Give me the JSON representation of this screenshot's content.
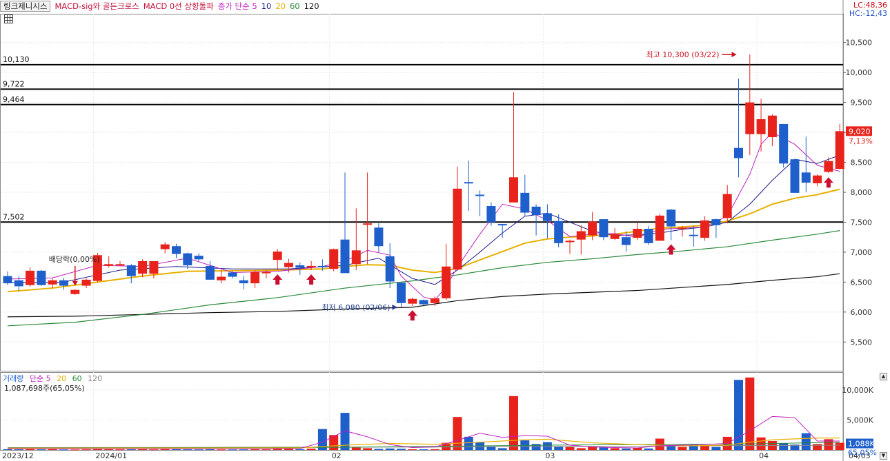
{
  "legend": {
    "name": "링크제니시스",
    "items": [
      {
        "text": "MACD-sig와 골든크로스",
        "color": "#c0103a"
      },
      {
        "text": "MACD 0선 상향돌파",
        "color": "#c0103a"
      },
      {
        "text": "종가 단순 5",
        "color": "#c020c0"
      },
      {
        "text": "10",
        "color": "#1a1a8a"
      },
      {
        "text": "20",
        "color": "#e8b000"
      },
      {
        "text": "60",
        "color": "#2a8a3a"
      },
      {
        "text": "120",
        "color": "#111111"
      }
    ]
  },
  "indicators": {
    "lc": "LC:48,36",
    "hc": "HC:-12,43"
  },
  "price_tag": {
    "value": "9,020",
    "pct": "7,13%"
  },
  "volume_legend": {
    "name": "거래량",
    "items": [
      {
        "text": "단순 5",
        "color": "#c020c0"
      },
      {
        "text": "20",
        "color": "#e8b000"
      },
      {
        "text": "60",
        "color": "#2a8a3a"
      },
      {
        "text": "120",
        "color": "#888888"
      }
    ],
    "info": "1,087,698주(65,05%)",
    "tag_value": "1,088K",
    "tag_pct": "65,05%"
  },
  "annotations": {
    "dividend": "배당락(0,00%)",
    "high": "최고 10,300 (03/22)",
    "low": "최저 6,080 (02/06)"
  },
  "colors": {
    "up": "#e8231c",
    "down": "#1e5fcc",
    "ma5": "#c020c0",
    "ma10": "#1a1a8a",
    "ma20": "#e8b000",
    "ma60": "#2a8a3a",
    "ma120": "#111111",
    "signal": "#cc0f2f"
  },
  "chart_data": {
    "type": "candlestick",
    "y_ticks": [
      "5,500",
      "6,000",
      "6,500",
      "7,000",
      "7,500",
      "8,000",
      "8,500",
      "9,000",
      "9,500",
      "10,000",
      "10,500"
    ],
    "ylim": [
      5020,
      10980
    ],
    "hlines": [
      {
        "value": 10130,
        "label": "10,130"
      },
      {
        "value": 9722,
        "label": "9,722"
      },
      {
        "value": 9464,
        "label": "9,464"
      },
      {
        "value": 7502,
        "label": "7,502"
      }
    ],
    "x_labels": [
      {
        "index": 0,
        "text": "2023/12"
      },
      {
        "index": 8,
        "text": "2024/01"
      },
      {
        "index": 29,
        "text": "02"
      },
      {
        "index": 48,
        "text": "03"
      },
      {
        "index": 67,
        "text": "04"
      },
      {
        "index": 72,
        "text": "04/03"
      }
    ],
    "candles": [
      {
        "o": 6600,
        "h": 6680,
        "l": 6450,
        "c": 6480
      },
      {
        "o": 6530,
        "h": 6600,
        "l": 6350,
        "c": 6430
      },
      {
        "o": 6450,
        "h": 6750,
        "l": 6420,
        "c": 6690
      },
      {
        "o": 6690,
        "h": 6700,
        "l": 6440,
        "c": 6450
      },
      {
        "o": 6460,
        "h": 6560,
        "l": 6400,
        "c": 6530
      },
      {
        "o": 6530,
        "h": 6570,
        "l": 6370,
        "c": 6440
      },
      {
        "o": 6300,
        "h": 6380,
        "l": 6290,
        "c": 6370
      },
      {
        "o": 6440,
        "h": 6560,
        "l": 6400,
        "c": 6540
      },
      {
        "o": 6520,
        "h": 6990,
        "l": 6500,
        "c": 6950
      },
      {
        "o": 6770,
        "h": 6930,
        "l": 6740,
        "c": 6800
      },
      {
        "o": 6790,
        "h": 6850,
        "l": 6770,
        "c": 6800
      },
      {
        "o": 6780,
        "h": 6800,
        "l": 6480,
        "c": 6600
      },
      {
        "o": 6640,
        "h": 6880,
        "l": 6580,
        "c": 6850
      },
      {
        "o": 6640,
        "h": 6820,
        "l": 6560,
        "c": 6850
      },
      {
        "o": 7050,
        "h": 7170,
        "l": 6980,
        "c": 7130
      },
      {
        "o": 7100,
        "h": 7140,
        "l": 6900,
        "c": 6970
      },
      {
        "o": 6980,
        "h": 6990,
        "l": 6720,
        "c": 6780
      },
      {
        "o": 6940,
        "h": 6980,
        "l": 6850,
        "c": 6880
      },
      {
        "o": 6770,
        "h": 6850,
        "l": 6560,
        "c": 6540
      },
      {
        "o": 6530,
        "h": 6700,
        "l": 6480,
        "c": 6590
      },
      {
        "o": 6660,
        "h": 6690,
        "l": 6560,
        "c": 6590
      },
      {
        "o": 6530,
        "h": 6600,
        "l": 6380,
        "c": 6480
      },
      {
        "o": 6480,
        "h": 6700,
        "l": 6400,
        "c": 6670
      },
      {
        "o": 6670,
        "h": 6700,
        "l": 6560,
        "c": 6670
      },
      {
        "o": 6870,
        "h": 7050,
        "l": 6700,
        "c": 7010
      },
      {
        "o": 6750,
        "h": 6890,
        "l": 6660,
        "c": 6820
      },
      {
        "o": 6780,
        "h": 6830,
        "l": 6620,
        "c": 6740
      },
      {
        "o": 6770,
        "h": 6850,
        "l": 6700,
        "c": 6770
      },
      {
        "o": 6770,
        "h": 6880,
        "l": 6690,
        "c": 6760
      },
      {
        "o": 6720,
        "h": 7060,
        "l": 6680,
        "c": 7050
      },
      {
        "o": 7210,
        "h": 8330,
        "l": 6700,
        "c": 6650
      },
      {
        "o": 6800,
        "h": 7730,
        "l": 6700,
        "c": 7030
      },
      {
        "o": 7470,
        "h": 8330,
        "l": 6800,
        "c": 7480
      },
      {
        "o": 7410,
        "h": 7480,
        "l": 7000,
        "c": 7100
      },
      {
        "o": 6930,
        "h": 7150,
        "l": 6400,
        "c": 6510
      },
      {
        "o": 6490,
        "h": 6500,
        "l": 6080,
        "c": 6150
      },
      {
        "o": 6140,
        "h": 6240,
        "l": 6100,
        "c": 6220
      },
      {
        "o": 6200,
        "h": 6210,
        "l": 6110,
        "c": 6130
      },
      {
        "o": 6150,
        "h": 6260,
        "l": 6100,
        "c": 6230
      },
      {
        "o": 6230,
        "h": 7140,
        "l": 6200,
        "c": 6760
      },
      {
        "o": 6710,
        "h": 8430,
        "l": 6700,
        "c": 8060
      },
      {
        "o": 8170,
        "h": 8530,
        "l": 7690,
        "c": 8160
      },
      {
        "o": 7960,
        "h": 8030,
        "l": 7600,
        "c": 7950
      },
      {
        "o": 7770,
        "h": 7830,
        "l": 7440,
        "c": 7500
      },
      {
        "o": 7470,
        "h": 7470,
        "l": 7240,
        "c": 7460
      },
      {
        "o": 7830,
        "h": 9670,
        "l": 7830,
        "c": 8250
      },
      {
        "o": 7990,
        "h": 8290,
        "l": 7610,
        "c": 7660
      },
      {
        "o": 7760,
        "h": 7800,
        "l": 7280,
        "c": 7620
      },
      {
        "o": 7650,
        "h": 7800,
        "l": 7230,
        "c": 7520
      },
      {
        "o": 7520,
        "h": 7630,
        "l": 7080,
        "c": 7150
      },
      {
        "o": 7180,
        "h": 7210,
        "l": 6970,
        "c": 7190
      },
      {
        "o": 7210,
        "h": 7450,
        "l": 6960,
        "c": 7350
      },
      {
        "o": 7280,
        "h": 7670,
        "l": 7200,
        "c": 7510
      },
      {
        "o": 7550,
        "h": 7550,
        "l": 7200,
        "c": 7250
      },
      {
        "o": 7220,
        "h": 7400,
        "l": 7200,
        "c": 7300
      },
      {
        "o": 7250,
        "h": 7350,
        "l": 7010,
        "c": 7120
      },
      {
        "o": 7240,
        "h": 7520,
        "l": 7200,
        "c": 7390
      },
      {
        "o": 7390,
        "h": 7440,
        "l": 7120,
        "c": 7150
      },
      {
        "o": 7190,
        "h": 7640,
        "l": 7190,
        "c": 7610
      },
      {
        "o": 7710,
        "h": 7720,
        "l": 7200,
        "c": 7430
      },
      {
        "o": 7410,
        "h": 7440,
        "l": 7260,
        "c": 7410
      },
      {
        "o": 7290,
        "h": 7440,
        "l": 7090,
        "c": 7280
      },
      {
        "o": 7240,
        "h": 7600,
        "l": 7190,
        "c": 7530
      },
      {
        "o": 7550,
        "h": 7560,
        "l": 7240,
        "c": 7450
      },
      {
        "o": 7570,
        "h": 8120,
        "l": 7480,
        "c": 7970
      },
      {
        "o": 8740,
        "h": 9900,
        "l": 8250,
        "c": 8570
      },
      {
        "o": 8970,
        "h": 10300,
        "l": 8620,
        "c": 9500
      },
      {
        "o": 8970,
        "h": 9560,
        "l": 8680,
        "c": 9220
      },
      {
        "o": 8920,
        "h": 9300,
        "l": 8770,
        "c": 9280
      },
      {
        "o": 9140,
        "h": 9140,
        "l": 8410,
        "c": 8480
      },
      {
        "o": 8550,
        "h": 8560,
        "l": 7990,
        "c": 7990
      },
      {
        "o": 8330,
        "h": 8930,
        "l": 8000,
        "c": 8160
      },
      {
        "o": 8150,
        "h": 8300,
        "l": 8100,
        "c": 8280
      },
      {
        "o": 8340,
        "h": 8580,
        "l": 8320,
        "c": 8520
      },
      {
        "o": 8390,
        "h": 9140,
        "l": 8380,
        "c": 9020
      }
    ],
    "ma5": [
      [
        0,
        6550
      ],
      [
        4,
        6570
      ],
      [
        8,
        6780
      ],
      [
        12,
        6760
      ],
      [
        16,
        6900
      ],
      [
        20,
        6660
      ],
      [
        24,
        6680
      ],
      [
        28,
        6760
      ],
      [
        30,
        6850
      ],
      [
        32,
        7030
      ],
      [
        34,
        6950
      ],
      [
        35,
        6600
      ],
      [
        37,
        6250
      ],
      [
        38,
        6200
      ],
      [
        39,
        6420
      ],
      [
        40,
        6750
      ],
      [
        42,
        7300
      ],
      [
        44,
        7800
      ],
      [
        46,
        7720
      ],
      [
        48,
        7530
      ],
      [
        50,
        7260
      ],
      [
        52,
        7300
      ],
      [
        54,
        7310
      ],
      [
        56,
        7250
      ],
      [
        58,
        7380
      ],
      [
        60,
        7400
      ],
      [
        62,
        7420
      ],
      [
        64,
        7600
      ],
      [
        66,
        8300
      ],
      [
        67,
        8800
      ],
      [
        68,
        9000
      ],
      [
        70,
        8800
      ],
      [
        72,
        8450
      ],
      [
        74,
        8350
      ]
    ],
    "ma10": [
      [
        0,
        6490
      ],
      [
        5,
        6500
      ],
      [
        10,
        6700
      ],
      [
        15,
        6760
      ],
      [
        20,
        6720
      ],
      [
        25,
        6720
      ],
      [
        30,
        6780
      ],
      [
        33,
        6900
      ],
      [
        36,
        6560
      ],
      [
        38,
        6460
      ],
      [
        40,
        6700
      ],
      [
        42,
        7000
      ],
      [
        44,
        7320
      ],
      [
        46,
        7600
      ],
      [
        48,
        7650
      ],
      [
        50,
        7500
      ],
      [
        52,
        7350
      ],
      [
        54,
        7280
      ],
      [
        56,
        7290
      ],
      [
        58,
        7320
      ],
      [
        60,
        7380
      ],
      [
        62,
        7420
      ],
      [
        64,
        7500
      ],
      [
        66,
        7800
      ],
      [
        68,
        8200
      ],
      [
        70,
        8550
      ],
      [
        72,
        8480
      ],
      [
        74,
        8620
      ]
    ],
    "ma20": [
      [
        0,
        6340
      ],
      [
        4,
        6400
      ],
      [
        8,
        6500
      ],
      [
        12,
        6600
      ],
      [
        16,
        6680
      ],
      [
        20,
        6690
      ],
      [
        24,
        6700
      ],
      [
        28,
        6720
      ],
      [
        30,
        6760
      ],
      [
        32,
        6790
      ],
      [
        34,
        6780
      ],
      [
        36,
        6700
      ],
      [
        38,
        6660
      ],
      [
        40,
        6730
      ],
      [
        42,
        6870
      ],
      [
        44,
        7010
      ],
      [
        46,
        7150
      ],
      [
        48,
        7220
      ],
      [
        50,
        7250
      ],
      [
        52,
        7270
      ],
      [
        54,
        7300
      ],
      [
        56,
        7350
      ],
      [
        58,
        7400
      ],
      [
        60,
        7420
      ],
      [
        62,
        7450
      ],
      [
        64,
        7520
      ],
      [
        66,
        7640
      ],
      [
        68,
        7800
      ],
      [
        70,
        7900
      ],
      [
        72,
        7960
      ],
      [
        74,
        8050
      ]
    ],
    "ma60": [
      [
        0,
        5770
      ],
      [
        6,
        5830
      ],
      [
        12,
        5960
      ],
      [
        18,
        6120
      ],
      [
        24,
        6240
      ],
      [
        30,
        6400
      ],
      [
        36,
        6520
      ],
      [
        40,
        6620
      ],
      [
        44,
        6740
      ],
      [
        48,
        6830
      ],
      [
        52,
        6890
      ],
      [
        56,
        6960
      ],
      [
        60,
        7020
      ],
      [
        64,
        7090
      ],
      [
        68,
        7200
      ],
      [
        72,
        7300
      ],
      [
        74,
        7360
      ]
    ],
    "ma120": [
      [
        0,
        5920
      ],
      [
        6,
        5930
      ],
      [
        12,
        5960
      ],
      [
        18,
        5990
      ],
      [
        24,
        6010
      ],
      [
        30,
        6050
      ],
      [
        36,
        6080
      ],
      [
        40,
        6190
      ],
      [
        44,
        6260
      ],
      [
        48,
        6300
      ],
      [
        52,
        6330
      ],
      [
        56,
        6360
      ],
      [
        60,
        6410
      ],
      [
        64,
        6460
      ],
      [
        68,
        6530
      ],
      [
        72,
        6590
      ],
      [
        74,
        6640
      ]
    ],
    "signals": [
      24,
      27,
      36,
      59,
      73
    ],
    "volume": {
      "ylim": [
        0,
        13000
      ],
      "y_ticks": [
        "5,000K",
        "10,000K"
      ],
      "values": [
        120,
        100,
        130,
        90,
        110,
        80,
        70,
        90,
        150,
        110,
        90,
        100,
        110,
        90,
        120,
        110,
        100,
        90,
        110,
        80,
        80,
        90,
        110,
        100,
        170,
        200,
        130,
        230,
        3500,
        2500,
        6200,
        400,
        300,
        180,
        250,
        200,
        120,
        110,
        130,
        1200,
        5500,
        2200,
        1300,
        600,
        300,
        9000,
        1600,
        1000,
        1300,
        600,
        500,
        300,
        600,
        400,
        300,
        250,
        350,
        250,
        1900,
        800,
        500,
        900,
        700,
        500,
        2200,
        11700,
        12100,
        2100,
        1500,
        1100,
        900,
        2800,
        1000,
        1800,
        1200
      ],
      "ma5": [
        [
          0,
          190
        ],
        [
          20,
          190
        ],
        [
          26,
          250
        ],
        [
          28,
          1300
        ],
        [
          30,
          3200
        ],
        [
          32,
          2200
        ],
        [
          34,
          900
        ],
        [
          36,
          400
        ],
        [
          38,
          500
        ],
        [
          40,
          1600
        ],
        [
          42,
          2800
        ],
        [
          44,
          2100
        ],
        [
          46,
          2400
        ],
        [
          48,
          2300
        ],
        [
          50,
          800
        ],
        [
          52,
          500
        ],
        [
          54,
          400
        ],
        [
          56,
          350
        ],
        [
          58,
          700
        ],
        [
          60,
          800
        ],
        [
          62,
          900
        ],
        [
          64,
          1100
        ],
        [
          66,
          3200
        ],
        [
          68,
          5600
        ],
        [
          70,
          5400
        ],
        [
          72,
          1500
        ],
        [
          74,
          1500
        ]
      ],
      "ma20": [
        [
          0,
          300
        ],
        [
          26,
          350
        ],
        [
          30,
          800
        ],
        [
          34,
          1100
        ],
        [
          38,
          950
        ],
        [
          42,
          1300
        ],
        [
          46,
          1700
        ],
        [
          48,
          1800
        ],
        [
          52,
          1200
        ],
        [
          56,
          900
        ],
        [
          60,
          700
        ],
        [
          64,
          800
        ],
        [
          66,
          1300
        ],
        [
          68,
          1700
        ],
        [
          72,
          2000
        ],
        [
          74,
          2000
        ]
      ],
      "ma60": [
        [
          0,
          330
        ],
        [
          30,
          450
        ],
        [
          40,
          650
        ],
        [
          48,
          800
        ],
        [
          56,
          900
        ],
        [
          66,
          1000
        ],
        [
          74,
          1300
        ]
      ],
      "ma120": [
        [
          0,
          400
        ],
        [
          40,
          500
        ],
        [
          74,
          800
        ]
      ]
    }
  }
}
